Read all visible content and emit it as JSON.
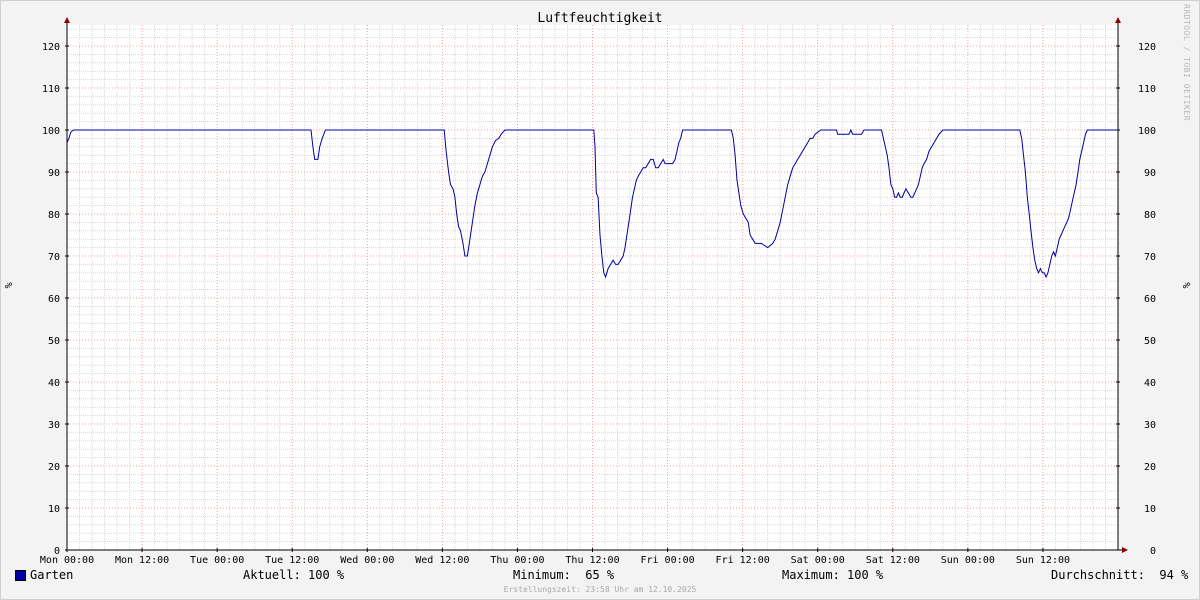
{
  "chart_data": {
    "type": "line",
    "title": "Luftfeuchtigkeit",
    "ylabel": "%",
    "ylim": [
      0,
      125
    ],
    "yticks": [
      0,
      10,
      20,
      30,
      40,
      50,
      60,
      70,
      80,
      90,
      100,
      110,
      120
    ],
    "x_range_hours": [
      0,
      168
    ],
    "xticks": [
      {
        "label": "Mon 00:00",
        "hour": 0
      },
      {
        "label": "Mon 12:00",
        "hour": 12
      },
      {
        "label": "Tue 00:00",
        "hour": 24
      },
      {
        "label": "Tue 12:00",
        "hour": 36
      },
      {
        "label": "Wed 00:00",
        "hour": 48
      },
      {
        "label": "Wed 12:00",
        "hour": 60
      },
      {
        "label": "Thu 00:00",
        "hour": 72
      },
      {
        "label": "Thu 12:00",
        "hour": 84
      },
      {
        "label": "Fri 00:00",
        "hour": 96
      },
      {
        "label": "Fri 12:00",
        "hour": 108
      },
      {
        "label": "Sat 00:00",
        "hour": 120
      },
      {
        "label": "Sat 12:00",
        "hour": 132
      },
      {
        "label": "Sun 00:00",
        "hour": 144
      },
      {
        "label": "Sun 12:00",
        "hour": 156
      }
    ],
    "grid": true,
    "series": [
      {
        "name": "Garten",
        "color": "#0000a0",
        "points": [
          [
            0,
            97
          ],
          [
            0.3,
            98
          ],
          [
            0.6,
            99.5
          ],
          [
            1,
            100
          ],
          [
            39,
            100
          ],
          [
            39.3,
            96
          ],
          [
            39.6,
            93
          ],
          [
            40.1,
            93
          ],
          [
            40.4,
            96
          ],
          [
            40.8,
            98
          ],
          [
            41.3,
            100
          ],
          [
            60.3,
            100
          ],
          [
            60.6,
            95
          ],
          [
            61,
            90
          ],
          [
            61.3,
            87
          ],
          [
            61.7,
            86
          ],
          [
            62,
            84
          ],
          [
            62.3,
            80
          ],
          [
            62.6,
            77
          ],
          [
            62.9,
            76
          ],
          [
            63.3,
            73
          ],
          [
            63.6,
            70
          ],
          [
            64,
            70
          ],
          [
            64.4,
            74
          ],
          [
            64.8,
            78
          ],
          [
            65.2,
            82
          ],
          [
            65.6,
            85
          ],
          [
            66,
            87
          ],
          [
            66.4,
            89
          ],
          [
            66.8,
            90
          ],
          [
            67.2,
            92
          ],
          [
            67.6,
            94
          ],
          [
            68,
            96
          ],
          [
            68.5,
            97.5
          ],
          [
            69,
            98
          ],
          [
            69.4,
            99
          ],
          [
            70,
            100
          ],
          [
            84.2,
            100
          ],
          [
            84.4,
            96
          ],
          [
            84.6,
            85
          ],
          [
            84.9,
            84
          ],
          [
            85.2,
            75
          ],
          [
            85.5,
            70
          ],
          [
            85.8,
            66
          ],
          [
            86.1,
            65
          ],
          [
            86.5,
            67
          ],
          [
            86.9,
            68
          ],
          [
            87.3,
            69
          ],
          [
            87.7,
            68
          ],
          [
            88.1,
            68
          ],
          [
            88.5,
            69
          ],
          [
            88.9,
            70
          ],
          [
            89.2,
            72
          ],
          [
            89.5,
            75
          ],
          [
            89.8,
            78
          ],
          [
            90.1,
            81
          ],
          [
            90.4,
            84
          ],
          [
            90.7,
            86
          ],
          [
            91,
            88
          ],
          [
            91.3,
            89
          ],
          [
            91.7,
            90
          ],
          [
            92.1,
            91
          ],
          [
            92.5,
            91
          ],
          [
            92.9,
            92
          ],
          [
            93.3,
            93
          ],
          [
            93.7,
            93
          ],
          [
            94.1,
            91
          ],
          [
            94.5,
            91
          ],
          [
            94.9,
            92
          ],
          [
            95.3,
            93
          ],
          [
            95.6,
            92
          ],
          [
            95.9,
            92
          ],
          [
            96.3,
            92
          ],
          [
            96.8,
            92
          ],
          [
            97.2,
            93
          ],
          [
            97.5,
            95
          ],
          [
            97.8,
            97
          ],
          [
            98.1,
            98
          ],
          [
            98.4,
            100
          ],
          [
            106.2,
            100
          ],
          [
            106.5,
            98
          ],
          [
            106.8,
            94
          ],
          [
            107.1,
            88
          ],
          [
            107.4,
            85
          ],
          [
            107.7,
            82
          ],
          [
            108.1,
            80
          ],
          [
            108.5,
            79
          ],
          [
            108.9,
            78
          ],
          [
            109.2,
            75
          ],
          [
            109.6,
            74
          ],
          [
            110,
            73
          ],
          [
            110.5,
            73
          ],
          [
            111,
            73
          ],
          [
            111.5,
            72.5
          ],
          [
            112,
            72
          ],
          [
            112.4,
            72.5
          ],
          [
            112.8,
            73
          ],
          [
            113.2,
            74
          ],
          [
            113.6,
            76
          ],
          [
            114,
            78
          ],
          [
            114.4,
            81
          ],
          [
            114.8,
            84
          ],
          [
            115.2,
            87
          ],
          [
            115.6,
            89
          ],
          [
            116,
            91
          ],
          [
            116.4,
            92
          ],
          [
            116.8,
            93
          ],
          [
            117.2,
            94
          ],
          [
            117.6,
            95
          ],
          [
            118,
            96
          ],
          [
            118.4,
            97
          ],
          [
            118.8,
            98
          ],
          [
            119.2,
            98
          ],
          [
            119.6,
            99
          ],
          [
            120,
            99.5
          ],
          [
            120.5,
            100
          ],
          [
            123,
            100
          ],
          [
            123.2,
            99
          ],
          [
            125,
            99
          ],
          [
            125.3,
            100
          ],
          [
            125.6,
            99
          ],
          [
            127,
            99
          ],
          [
            127.4,
            100
          ],
          [
            130.2,
            100
          ],
          [
            130.5,
            98
          ],
          [
            130.8,
            96
          ],
          [
            131.1,
            94
          ],
          [
            131.4,
            91
          ],
          [
            131.7,
            87
          ],
          [
            132,
            86
          ],
          [
            132.3,
            84
          ],
          [
            132.6,
            84
          ],
          [
            132.9,
            85
          ],
          [
            133.2,
            84
          ],
          [
            133.5,
            84
          ],
          [
            133.8,
            85
          ],
          [
            134.1,
            86
          ],
          [
            134.5,
            85
          ],
          [
            134.9,
            84
          ],
          [
            135.2,
            84
          ],
          [
            135.5,
            85
          ],
          [
            135.8,
            86
          ],
          [
            136.1,
            87
          ],
          [
            136.4,
            89
          ],
          [
            136.7,
            91
          ],
          [
            137,
            92
          ],
          [
            137.4,
            93
          ],
          [
            137.8,
            95
          ],
          [
            138.2,
            96
          ],
          [
            138.6,
            97
          ],
          [
            139,
            98
          ],
          [
            139.4,
            99
          ],
          [
            140,
            100
          ],
          [
            152.3,
            100
          ],
          [
            152.6,
            98
          ],
          [
            152.9,
            94
          ],
          [
            153.2,
            90
          ],
          [
            153.5,
            84
          ],
          [
            153.8,
            80
          ],
          [
            154.1,
            76
          ],
          [
            154.4,
            72
          ],
          [
            154.7,
            69
          ],
          [
            155,
            67
          ],
          [
            155.3,
            66
          ],
          [
            155.6,
            67
          ],
          [
            155.9,
            66
          ],
          [
            156.2,
            66
          ],
          [
            156.5,
            65
          ],
          [
            156.8,
            66
          ],
          [
            157.1,
            68
          ],
          [
            157.4,
            70
          ],
          [
            157.7,
            71
          ],
          [
            158,
            70
          ],
          [
            158.3,
            72
          ],
          [
            158.6,
            74
          ],
          [
            158.9,
            75
          ],
          [
            159.2,
            76
          ],
          [
            159.5,
            77
          ],
          [
            159.8,
            78
          ],
          [
            160.1,
            79
          ],
          [
            160.4,
            81
          ],
          [
            160.7,
            83
          ],
          [
            161,
            85
          ],
          [
            161.3,
            87
          ],
          [
            161.6,
            90
          ],
          [
            161.9,
            93
          ],
          [
            162.2,
            95
          ],
          [
            162.5,
            97
          ],
          [
            162.8,
            99
          ],
          [
            163.1,
            100
          ],
          [
            168,
            100
          ]
        ]
      }
    ],
    "legend_position": "bottom"
  },
  "legend": {
    "series_name": "Garten",
    "current": "Aktuell: 100 %",
    "minimum": "Minimum:  65 %",
    "maximum": "Maximum: 100 %",
    "average": "Durchschnitt:  94 %"
  },
  "watermark": "RRDTOOL / TOBI OETIKER",
  "footer": "Erstellungszeit: 23:58 Uhr am 12.10.2025",
  "colors": {
    "line": "#0000a0",
    "major_grid": "#f0a0a0",
    "minor_grid": "#d8d8d8",
    "arrow": "#8b0000"
  }
}
